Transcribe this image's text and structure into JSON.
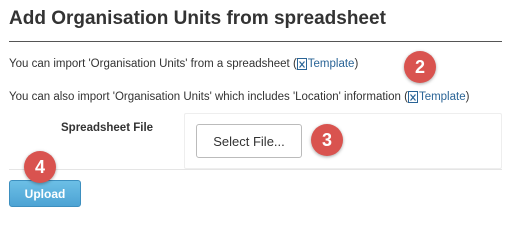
{
  "header": {
    "title": "Add Organisation Units from spreadsheet"
  },
  "info": {
    "line1_prefix": "You can import 'Organisation Units' from a spreadsheet (",
    "line1_link": "Template",
    "line1_suffix": ")",
    "line2_prefix": "You can also import 'Organisation Units' which includes 'Location' information (",
    "line2_link": "Template",
    "line2_suffix": ")"
  },
  "form": {
    "spreadsheet_label": "Spreadsheet File",
    "select_file_label": "Select File..."
  },
  "actions": {
    "upload_label": "Upload"
  },
  "callouts": {
    "two": "2",
    "three": "3",
    "four": "4"
  },
  "icons": {
    "template": "excel-file-icon"
  },
  "colors": {
    "link": "#2a6496",
    "callout": "#d9534f",
    "upload_button": "#5bc0de",
    "title_rule": "#555555"
  }
}
